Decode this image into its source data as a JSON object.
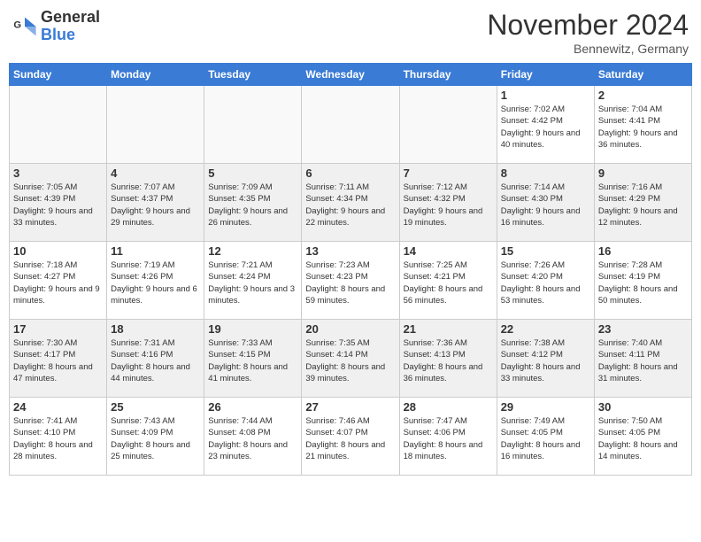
{
  "header": {
    "logo_general": "General",
    "logo_blue": "Blue",
    "month_title": "November 2024",
    "location": "Bennewitz, Germany"
  },
  "days_of_week": [
    "Sunday",
    "Monday",
    "Tuesday",
    "Wednesday",
    "Thursday",
    "Friday",
    "Saturday"
  ],
  "weeks": [
    [
      {
        "day": "",
        "info": ""
      },
      {
        "day": "",
        "info": ""
      },
      {
        "day": "",
        "info": ""
      },
      {
        "day": "",
        "info": ""
      },
      {
        "day": "",
        "info": ""
      },
      {
        "day": "1",
        "info": "Sunrise: 7:02 AM\nSunset: 4:42 PM\nDaylight: 9 hours and 40 minutes."
      },
      {
        "day": "2",
        "info": "Sunrise: 7:04 AM\nSunset: 4:41 PM\nDaylight: 9 hours and 36 minutes."
      }
    ],
    [
      {
        "day": "3",
        "info": "Sunrise: 7:05 AM\nSunset: 4:39 PM\nDaylight: 9 hours and 33 minutes."
      },
      {
        "day": "4",
        "info": "Sunrise: 7:07 AM\nSunset: 4:37 PM\nDaylight: 9 hours and 29 minutes."
      },
      {
        "day": "5",
        "info": "Sunrise: 7:09 AM\nSunset: 4:35 PM\nDaylight: 9 hours and 26 minutes."
      },
      {
        "day": "6",
        "info": "Sunrise: 7:11 AM\nSunset: 4:34 PM\nDaylight: 9 hours and 22 minutes."
      },
      {
        "day": "7",
        "info": "Sunrise: 7:12 AM\nSunset: 4:32 PM\nDaylight: 9 hours and 19 minutes."
      },
      {
        "day": "8",
        "info": "Sunrise: 7:14 AM\nSunset: 4:30 PM\nDaylight: 9 hours and 16 minutes."
      },
      {
        "day": "9",
        "info": "Sunrise: 7:16 AM\nSunset: 4:29 PM\nDaylight: 9 hours and 12 minutes."
      }
    ],
    [
      {
        "day": "10",
        "info": "Sunrise: 7:18 AM\nSunset: 4:27 PM\nDaylight: 9 hours and 9 minutes."
      },
      {
        "day": "11",
        "info": "Sunrise: 7:19 AM\nSunset: 4:26 PM\nDaylight: 9 hours and 6 minutes."
      },
      {
        "day": "12",
        "info": "Sunrise: 7:21 AM\nSunset: 4:24 PM\nDaylight: 9 hours and 3 minutes."
      },
      {
        "day": "13",
        "info": "Sunrise: 7:23 AM\nSunset: 4:23 PM\nDaylight: 8 hours and 59 minutes."
      },
      {
        "day": "14",
        "info": "Sunrise: 7:25 AM\nSunset: 4:21 PM\nDaylight: 8 hours and 56 minutes."
      },
      {
        "day": "15",
        "info": "Sunrise: 7:26 AM\nSunset: 4:20 PM\nDaylight: 8 hours and 53 minutes."
      },
      {
        "day": "16",
        "info": "Sunrise: 7:28 AM\nSunset: 4:19 PM\nDaylight: 8 hours and 50 minutes."
      }
    ],
    [
      {
        "day": "17",
        "info": "Sunrise: 7:30 AM\nSunset: 4:17 PM\nDaylight: 8 hours and 47 minutes."
      },
      {
        "day": "18",
        "info": "Sunrise: 7:31 AM\nSunset: 4:16 PM\nDaylight: 8 hours and 44 minutes."
      },
      {
        "day": "19",
        "info": "Sunrise: 7:33 AM\nSunset: 4:15 PM\nDaylight: 8 hours and 41 minutes."
      },
      {
        "day": "20",
        "info": "Sunrise: 7:35 AM\nSunset: 4:14 PM\nDaylight: 8 hours and 39 minutes."
      },
      {
        "day": "21",
        "info": "Sunrise: 7:36 AM\nSunset: 4:13 PM\nDaylight: 8 hours and 36 minutes."
      },
      {
        "day": "22",
        "info": "Sunrise: 7:38 AM\nSunset: 4:12 PM\nDaylight: 8 hours and 33 minutes."
      },
      {
        "day": "23",
        "info": "Sunrise: 7:40 AM\nSunset: 4:11 PM\nDaylight: 8 hours and 31 minutes."
      }
    ],
    [
      {
        "day": "24",
        "info": "Sunrise: 7:41 AM\nSunset: 4:10 PM\nDaylight: 8 hours and 28 minutes."
      },
      {
        "day": "25",
        "info": "Sunrise: 7:43 AM\nSunset: 4:09 PM\nDaylight: 8 hours and 25 minutes."
      },
      {
        "day": "26",
        "info": "Sunrise: 7:44 AM\nSunset: 4:08 PM\nDaylight: 8 hours and 23 minutes."
      },
      {
        "day": "27",
        "info": "Sunrise: 7:46 AM\nSunset: 4:07 PM\nDaylight: 8 hours and 21 minutes."
      },
      {
        "day": "28",
        "info": "Sunrise: 7:47 AM\nSunset: 4:06 PM\nDaylight: 8 hours and 18 minutes."
      },
      {
        "day": "29",
        "info": "Sunrise: 7:49 AM\nSunset: 4:05 PM\nDaylight: 8 hours and 16 minutes."
      },
      {
        "day": "30",
        "info": "Sunrise: 7:50 AM\nSunset: 4:05 PM\nDaylight: 8 hours and 14 minutes."
      }
    ]
  ]
}
